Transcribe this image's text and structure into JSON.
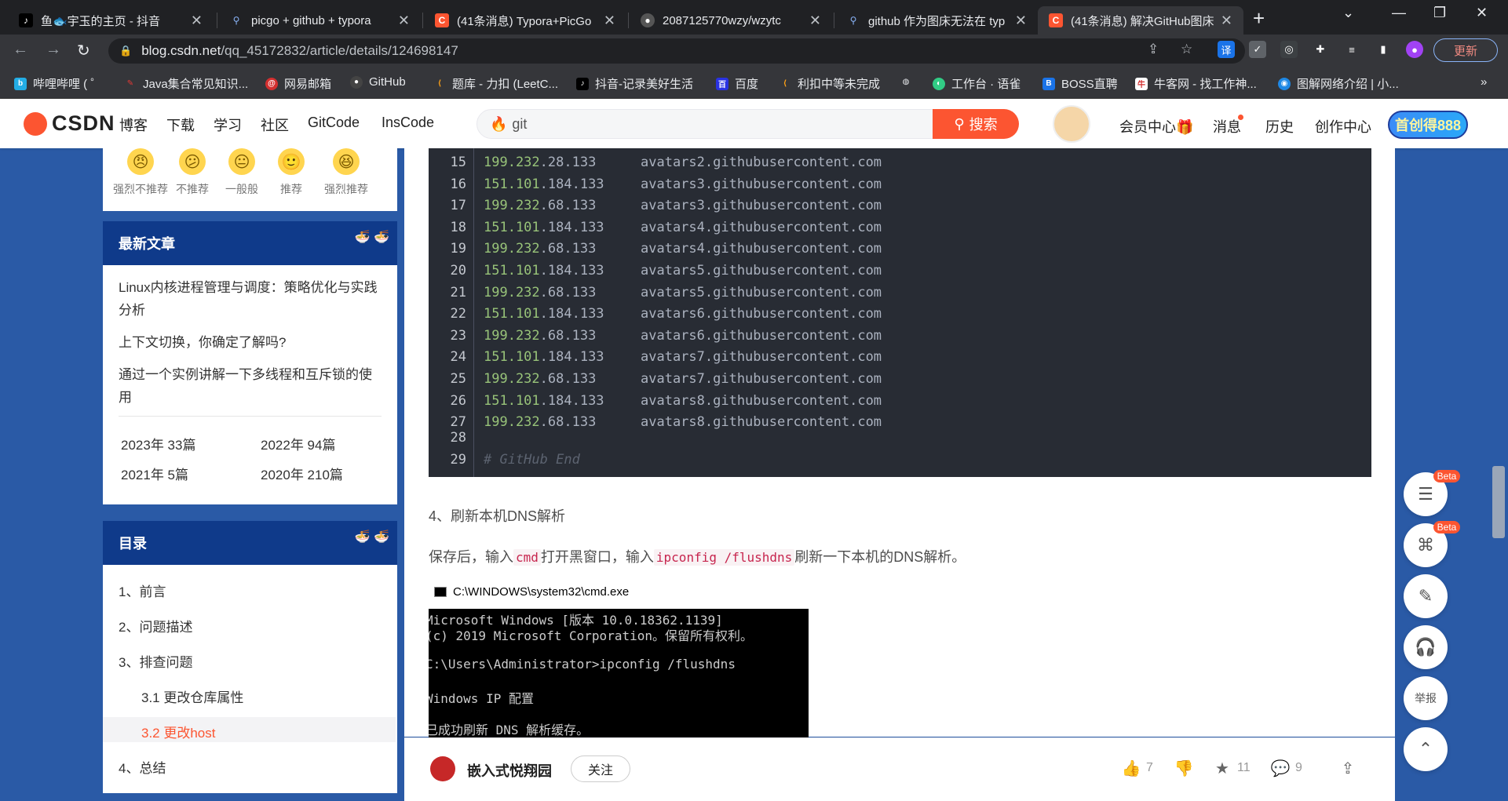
{
  "browser": {
    "tabs": [
      {
        "title": "鱼🐟宇玉的主页 - 抖音",
        "icon": "tiktok-icon",
        "active": false
      },
      {
        "title": "picgo + github + typora",
        "icon": "search-icon",
        "active": false
      },
      {
        "title": "(41条消息) Typora+PicGo",
        "icon": "csdn-icon",
        "active": false
      },
      {
        "title": "2087125770wzy/wzytc",
        "icon": "github-icon",
        "active": false
      },
      {
        "title": "github 作为图床无法在 typ",
        "icon": "search-icon",
        "active": false
      },
      {
        "title": "(41条消息) 解决GitHub图床",
        "icon": "csdn-icon",
        "active": true
      }
    ],
    "url_domain": "blog.csdn.net",
    "url_path": "/qq_45172832/article/details/124698147",
    "update_label": "更新",
    "bookmarks": [
      "哔哩哔哩 ( ゜",
      "Java集合常见知识...",
      "网易邮箱",
      "GitHub",
      "题库 - 力扣 (LeetC...",
      "抖音-记录美好生活",
      "百度",
      "利扣中等未完成",
      "工作台 · 语雀",
      "BOSS直聘",
      "牛客网 - 找工作神...",
      "图解网络介绍 | 小..."
    ]
  },
  "csdn": {
    "logo": "CSDN",
    "nav": [
      "博客",
      "下载",
      "学习",
      "社区",
      "GitCode",
      "InsCode"
    ],
    "search_query": "git",
    "search_button": "搜索",
    "right_nav": [
      "会员中心",
      "消息",
      "历史",
      "创作中心"
    ],
    "cta": "首创得888"
  },
  "sidebar": {
    "ratings": [
      "强烈不推荐",
      "不推荐",
      "一般般",
      "推荐",
      "强烈推荐"
    ],
    "latest_title": "最新文章",
    "latest_articles": [
      "Linux内核进程管理与调度：策略优化与实践分析",
      "上下文切换，你确定了解吗?",
      "通过一个实例讲解一下多线程和互斥锁的使用"
    ],
    "archive": [
      "2023年  33篇",
      "2022年  94篇",
      "2021年  5篇",
      "2020年  210篇"
    ],
    "toc_title": "目录",
    "toc": [
      "1、前言",
      "2、问题描述",
      "3、排查问题",
      "3.1 更改仓库属性",
      "3.2 更改host",
      "4、总结"
    ]
  },
  "article": {
    "code_lines": [
      {
        "n": "15",
        "ip_a": "199.232",
        "ip_b": ".28.133",
        "host": "avatars2.githubusercontent.com"
      },
      {
        "n": "16",
        "ip_a": "151.101",
        "ip_b": ".184.133",
        "host": "avatars3.githubusercontent.com"
      },
      {
        "n": "17",
        "ip_a": "199.232",
        "ip_b": ".68.133",
        "host": "avatars3.githubusercontent.com"
      },
      {
        "n": "18",
        "ip_a": "151.101",
        "ip_b": ".184.133",
        "host": "avatars4.githubusercontent.com"
      },
      {
        "n": "19",
        "ip_a": "199.232",
        "ip_b": ".68.133",
        "host": "avatars4.githubusercontent.com"
      },
      {
        "n": "20",
        "ip_a": "151.101",
        "ip_b": ".184.133",
        "host": "avatars5.githubusercontent.com"
      },
      {
        "n": "21",
        "ip_a": "199.232",
        "ip_b": ".68.133",
        "host": "avatars5.githubusercontent.com"
      },
      {
        "n": "22",
        "ip_a": "151.101",
        "ip_b": ".184.133",
        "host": "avatars6.githubusercontent.com"
      },
      {
        "n": "23",
        "ip_a": "199.232",
        "ip_b": ".68.133",
        "host": "avatars6.githubusercontent.com"
      },
      {
        "n": "24",
        "ip_a": "151.101",
        "ip_b": ".184.133",
        "host": "avatars7.githubusercontent.com"
      },
      {
        "n": "25",
        "ip_a": "199.232",
        "ip_b": ".68.133",
        "host": "avatars7.githubusercontent.com"
      },
      {
        "n": "26",
        "ip_a": "151.101",
        "ip_b": ".184.133",
        "host": "avatars8.githubusercontent.com"
      },
      {
        "n": "27",
        "ip_a": "199.232",
        "ip_b": ".68.133",
        "host": "avatars8.githubusercontent.com"
      }
    ],
    "line_28": "28",
    "line_29": "29",
    "comment": "# GitHub End",
    "heading4": "4、刷新本机DNS解析",
    "para_before_cmd": "保存后，输入",
    "inline_cmd": "cmd",
    "para_mid": "打开黑窗口，输入",
    "inline_flush": "ipconfig /flushdns",
    "para_after": "刷新一下本机的DNS解析。",
    "cmd_title": "C:\\WINDOWS\\system32\\cmd.exe",
    "cmd_lines": [
      "Microsoft Windows [版本 10.0.18362.1139]",
      "(c) 2019 Microsoft Corporation。保留所有权利。",
      "",
      "C:\\Users\\Administrator>ipconfig /flushdns",
      "",
      "Windows IP 配置",
      "",
      "已成功刷新 DNS 解析缓存。"
    ]
  },
  "footer": {
    "author": "嵌入式悦翔园",
    "follow": "关注",
    "likes": "7",
    "favorites": "11",
    "comments": "9"
  },
  "float": {
    "beta": "Beta",
    "report": "举报"
  }
}
